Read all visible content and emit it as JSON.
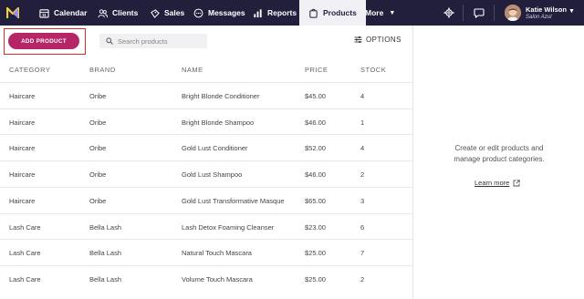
{
  "nav": {
    "items": [
      {
        "label": "Calendar",
        "icon": "calendar-icon"
      },
      {
        "label": "Clients",
        "icon": "clients-icon"
      },
      {
        "label": "Sales",
        "icon": "sales-icon"
      },
      {
        "label": "Messages",
        "icon": "messages-icon"
      },
      {
        "label": "Reports",
        "icon": "reports-icon"
      },
      {
        "label": "Products",
        "icon": "products-icon",
        "active": true
      },
      {
        "label": "More",
        "icon": "chevron-down-icon"
      }
    ],
    "user": {
      "name": "Katie Wilson",
      "salon": "Salon Azul"
    },
    "colors": {
      "bar": "#221f3d",
      "accent": "#b62567",
      "highlight": "#d62c2c"
    }
  },
  "toolbar": {
    "add_label": "ADD PRODUCT",
    "search_placeholder": "Search products",
    "options_label": "OPTIONS"
  },
  "table": {
    "headers": [
      "CATEGORY",
      "BRAND",
      "NAME",
      "PRICE",
      "STOCK"
    ],
    "rows": [
      [
        "Haircare",
        "Oribe",
        "Bright Blonde Conditioner",
        "$45.00",
        "4"
      ],
      [
        "Haircare",
        "Oribe",
        "Bright Blonde Shampoo",
        "$46.00",
        "1"
      ],
      [
        "Haircare",
        "Oribe",
        "Gold Lust Conditioner",
        "$52.00",
        "4"
      ],
      [
        "Haircare",
        "Oribe",
        "Gold Lust Shampoo",
        "$46.00",
        "2"
      ],
      [
        "Haircare",
        "Oribe",
        "Gold Lust Transformative Masque",
        "$65.00",
        "3"
      ],
      [
        "Lash Care",
        "Bella Lash",
        "Lash Detox Foaming Cleanser",
        "$23.00",
        "6"
      ],
      [
        "Lash Care",
        "Bella Lash",
        "Natural Touch Mascara",
        "$25.00",
        "7"
      ],
      [
        "Lash Care",
        "Bella Lash",
        "Volume Touch Mascara",
        "$25.00",
        "2"
      ]
    ]
  },
  "side_panel": {
    "message_line1": "Create or edit products and",
    "message_line2": "manage product categories.",
    "link_label": "Learn more"
  }
}
